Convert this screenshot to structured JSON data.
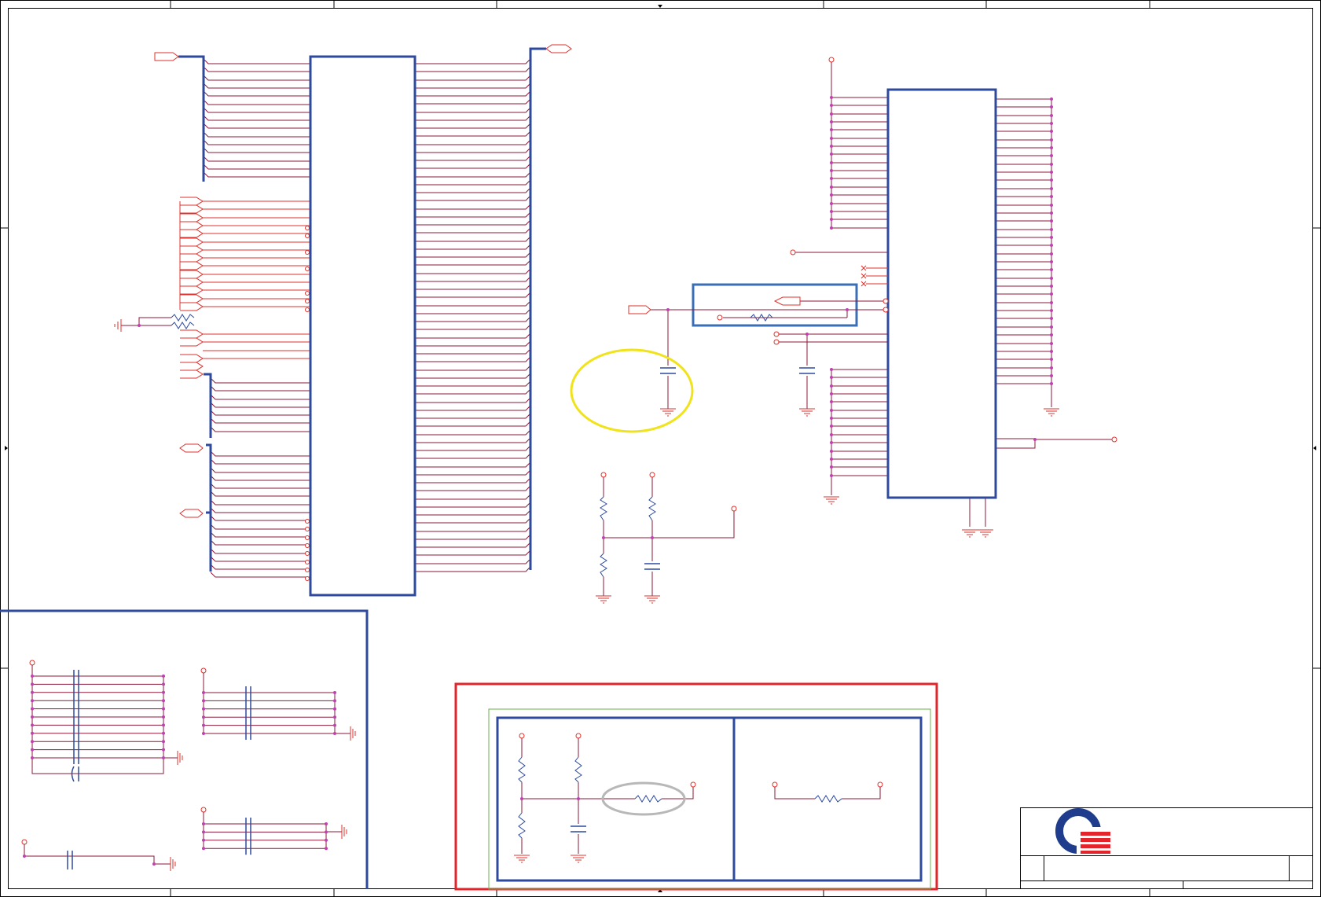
{
  "sheet": {
    "colors": {
      "frame": "#000000",
      "net": "#e0302b",
      "wire": "#8b1a3a",
      "bus": "#2d4a9e",
      "junction": "#c040b0",
      "part": "#2d4aa0",
      "highlight_red": "#e3242b",
      "highlight_yellow": "#f0e31a",
      "highlight_blue": "#3a6fb5",
      "highlight_gray": "#b8b8b8",
      "highlight_green": "#6ab04c",
      "logo_blue": "#1f3d8c",
      "logo_red": "#e3242b"
    },
    "logo_icon": "company-logo-q"
  }
}
